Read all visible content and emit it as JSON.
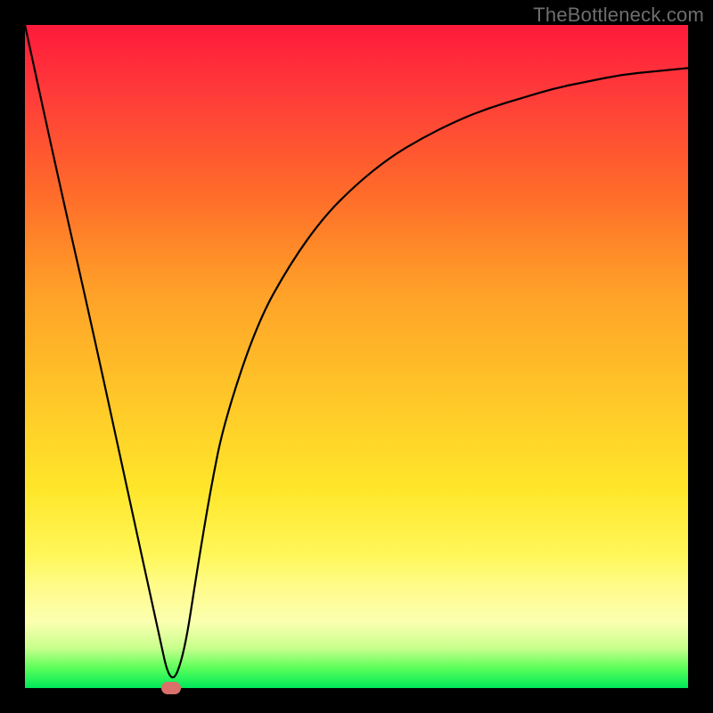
{
  "watermark": "TheBottleneck.com",
  "colors": {
    "frame_bg": "#000000",
    "curve_stroke": "#000000",
    "marker_fill": "#d9706a",
    "watermark_text": "#6e6e6e"
  },
  "chart_data": {
    "type": "line",
    "title": "",
    "xlabel": "",
    "ylabel": "",
    "xlim": [
      0,
      100
    ],
    "ylim": [
      0,
      100
    ],
    "grid": false,
    "legend": false,
    "series": [
      {
        "name": "bottleneck-curve",
        "x": [
          0,
          5,
          10,
          15,
          20,
          22,
          24,
          26,
          28,
          30,
          35,
          40,
          45,
          50,
          55,
          60,
          65,
          70,
          75,
          80,
          85,
          90,
          95,
          100
        ],
        "y": [
          100,
          77,
          55,
          32,
          9,
          0,
          5,
          18,
          30,
          40,
          55,
          64,
          71,
          76,
          80,
          83,
          85.5,
          87.5,
          89,
          90.5,
          91.5,
          92.5,
          93,
          93.5
        ]
      }
    ],
    "marker": {
      "x": 22,
      "y": 0
    }
  }
}
